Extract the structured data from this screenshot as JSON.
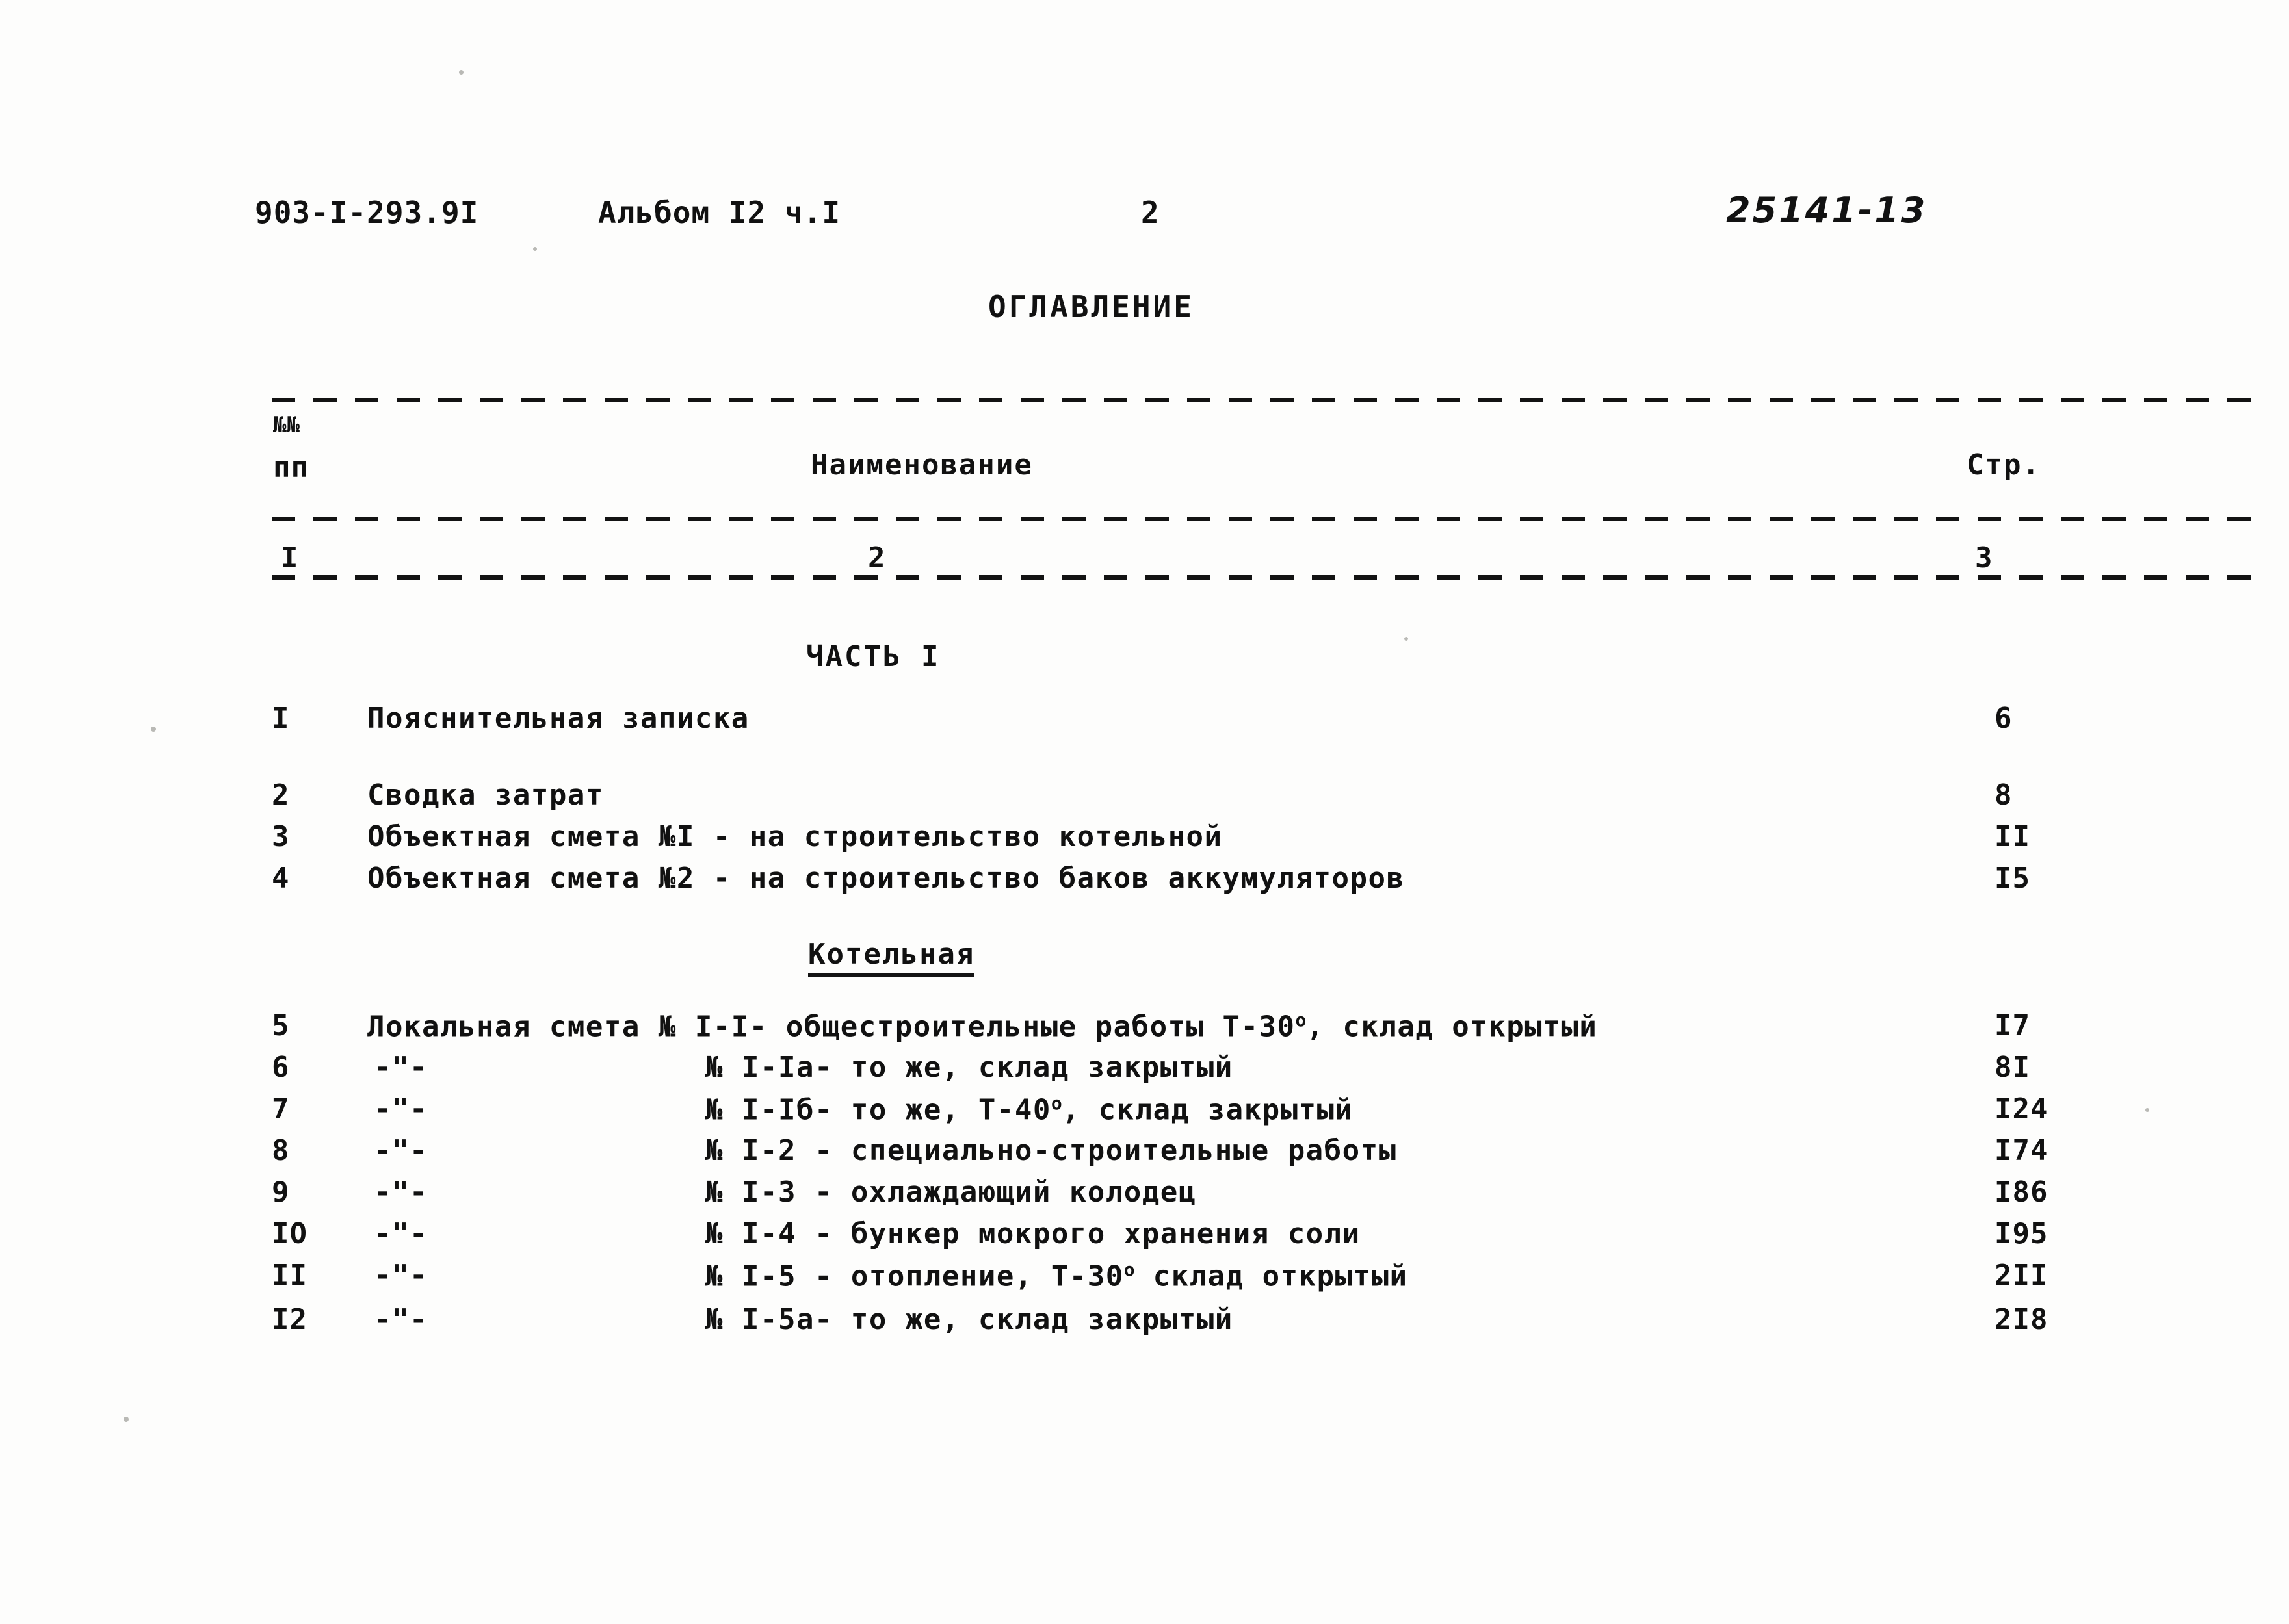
{
  "header": {
    "doc_code": "903-I-293.9I",
    "album": "Альбом I2 ч.I",
    "page_number": "2",
    "stamp_number": "25141-13"
  },
  "title": "ОГЛАВЛЕНИЕ",
  "table": {
    "columns": {
      "no_line1": "№№",
      "no_line2": "пп",
      "name": "Наименование",
      "page": "Стр."
    },
    "column_numbers": {
      "c1": "I",
      "c2": "2",
      "c3": "3"
    }
  },
  "sections": {
    "part1": "ЧАСТЬ I",
    "boiler": "Котельная"
  },
  "entries": [
    {
      "num": "I",
      "ditto": "",
      "name_pre": "Пояснительная записка",
      "sup": "",
      "name_post": "",
      "page": "6"
    },
    {
      "num": "2",
      "ditto": "",
      "name_pre": "Сводка затрат",
      "sup": "",
      "name_post": "",
      "page": "8"
    },
    {
      "num": "3",
      "ditto": "",
      "name_pre": "Объектная смета №I - на строительство котельной",
      "sup": "",
      "name_post": "",
      "page": "II"
    },
    {
      "num": "4",
      "ditto": "",
      "name_pre": "Объектная смета №2 - на строительство баков аккумуляторов",
      "sup": "",
      "name_post": "",
      "page": "I5"
    },
    {
      "num": "5",
      "ditto": "",
      "name_pre": "Локальная смета № I-I- общестроительные работы Т-30",
      "sup": "о",
      "name_post": ", склад открытый",
      "page": "I7"
    },
    {
      "num": "6",
      "ditto": "-\"-",
      "name_pre": "№ I-Ia- то же, склад закрытый",
      "sup": "",
      "name_post": "",
      "page": "8I"
    },
    {
      "num": "7",
      "ditto": "-\"-",
      "name_pre": "№ I-Iб- то же, Т-40",
      "sup": "о",
      "name_post": ", склад закрытый",
      "page": "I24"
    },
    {
      "num": "8",
      "ditto": "-\"-",
      "name_pre": "№ I-2 - специально-строительные работы",
      "sup": "",
      "name_post": "",
      "page": "I74"
    },
    {
      "num": "9",
      "ditto": "-\"-",
      "name_pre": "№ I-3 - охлаждающий колодец",
      "sup": "",
      "name_post": "",
      "page": "I86"
    },
    {
      "num": "IO",
      "ditto": "-\"-",
      "name_pre": "№ I-4 - бункер мокрого хранения соли",
      "sup": "",
      "name_post": "",
      "page": "I95"
    },
    {
      "num": "II",
      "ditto": "-\"-",
      "name_pre": "№ I-5 - отопление, Т-30",
      "sup": "о",
      "name_post": " склад открытый",
      "page": "2II"
    },
    {
      "num": "I2",
      "ditto": "-\"-",
      "name_pre": "№ I-5a- то же, склад закрытый",
      "sup": "",
      "name_post": "",
      "page": "2I8"
    }
  ]
}
